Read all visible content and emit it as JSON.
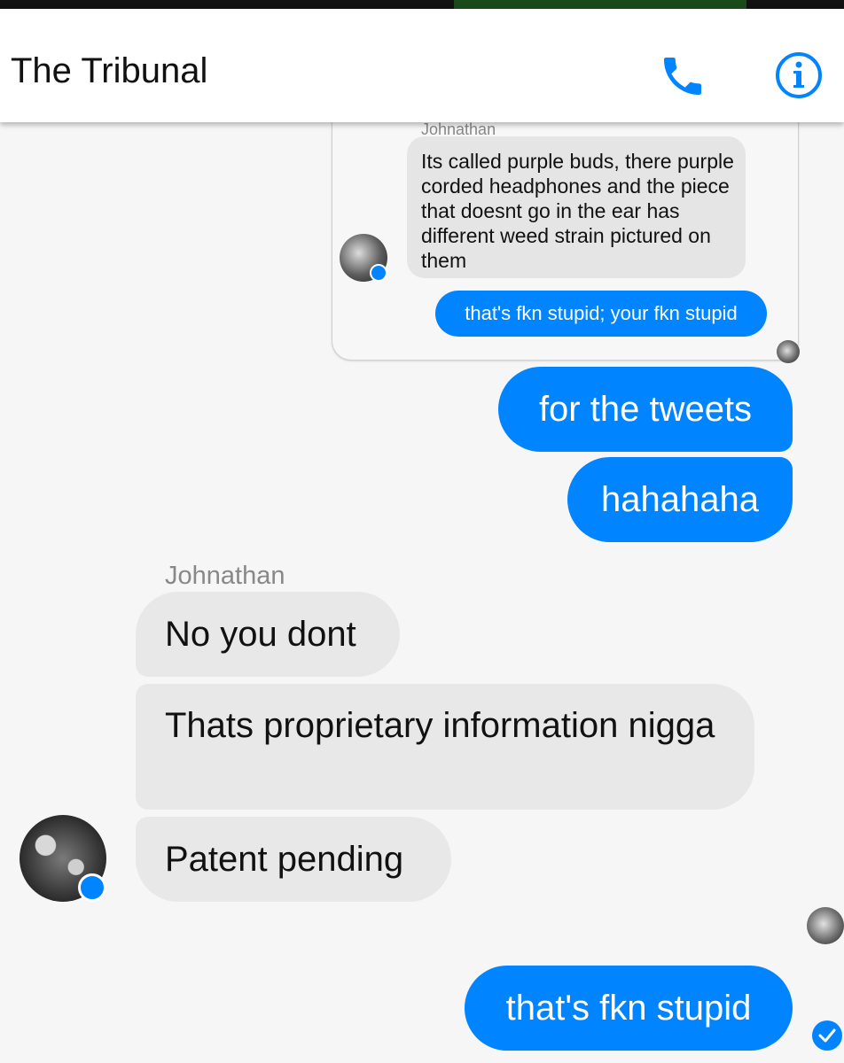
{
  "header": {
    "title": "The Tribunal",
    "call_icon": "phone-icon",
    "info_icon": "info-icon",
    "accent_color": "#0084ff"
  },
  "quoted": {
    "sender": "Johnathan",
    "incoming_text": "Its called purple buds, there purple corded headphones and the piece that doesnt go in the ear has different weed strain pictured on them",
    "outgoing_text": "that's fkn stupid; your fkn stupid"
  },
  "messages": {
    "out_1": "for the tweets",
    "out_2": "hahahaha",
    "sender_name": "Johnathan",
    "in_1": "No you dont",
    "in_2": "Thats proprietary information nigga",
    "in_3": "Patent pending",
    "out_3": "that's fkn stupid"
  },
  "colors": {
    "outgoing_bubble": "#0084ff",
    "incoming_bubble": "#e8e8e8",
    "background": "#f6f6f6"
  }
}
